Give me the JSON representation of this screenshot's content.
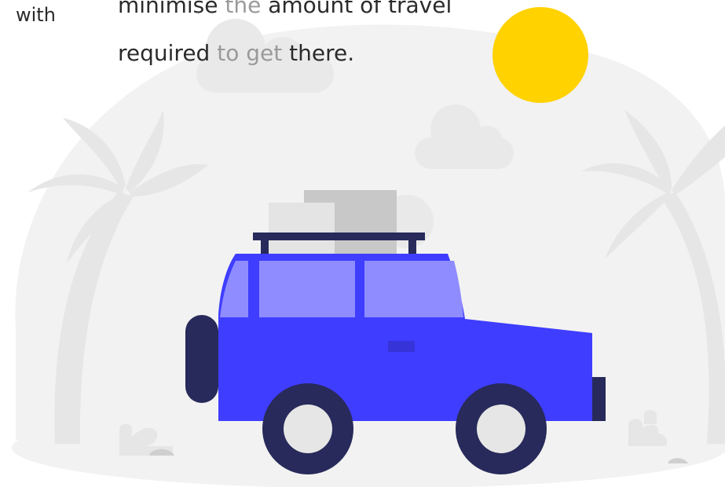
{
  "text": {
    "left_fragment": "with",
    "line1": {
      "part1": "minimise ",
      "part2": "the",
      "part3": " amount of travel"
    },
    "line2": {
      "part1": "required ",
      "part2": "to get",
      "part3": " there."
    }
  },
  "colors": {
    "background_blob": "#f2f2f2",
    "palm": "#e6e6e6",
    "cloud": "#e9e9e9",
    "sun": "#ffd200",
    "car_body": "#3f3dff",
    "car_windows": "#8f8cff",
    "car_dark": "#272a5a",
    "tire_hub": "#e6e6e6",
    "luggage_light": "#e4e4e4",
    "luggage_dark": "#c8c8c8"
  },
  "icons": [
    "sun-icon",
    "cloud-icon",
    "palm-tree-icon",
    "jeep-icon",
    "bush-icon",
    "stone-icon"
  ]
}
